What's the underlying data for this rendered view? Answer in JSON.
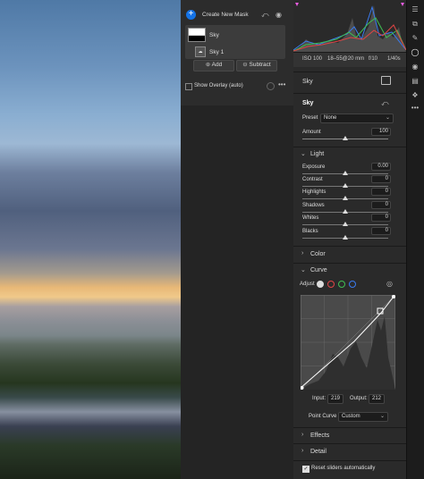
{
  "mask_panel": {
    "create_label": "Create New Mask",
    "mask_name": "Sky",
    "sub_mask_name": "Sky 1",
    "add_label": "Add",
    "subtract_label": "Subtract",
    "show_overlay_label": "Show Overlay (auto)"
  },
  "camera_info": [
    "ISO 100",
    "18–55@20 mm",
    "f/10",
    "1/40s"
  ],
  "section_title": "Sky",
  "preset": {
    "label": "Preset",
    "value": "None"
  },
  "amount": {
    "label": "Amount",
    "value": "100"
  },
  "light": {
    "title": "Light",
    "sliders": [
      {
        "label": "Exposure",
        "value": "0.00"
      },
      {
        "label": "Contrast",
        "value": "0"
      },
      {
        "label": "Highlights",
        "value": "0"
      },
      {
        "label": "Shadows",
        "value": "0"
      },
      {
        "label": "Whites",
        "value": "0"
      },
      {
        "label": "Blacks",
        "value": "0"
      }
    ]
  },
  "color_title": "Color",
  "curve": {
    "title": "Curve",
    "adjust_label": "Adjust",
    "input_label": "Input:",
    "input_value": "219",
    "output_label": "Output:",
    "output_value": "212",
    "point_curve_label": "Point Curve",
    "point_curve_value": "Custom"
  },
  "effects_title": "Effects",
  "detail_title": "Detail",
  "reset_label": "Reset sliders automatically",
  "colors": {
    "accent": "#1473e6",
    "red": "#e04545",
    "green": "#3fbf52",
    "blue": "#3a7bf0"
  },
  "icons": [
    "sliders-icon",
    "crop-icon",
    "brush-icon",
    "mask-icon",
    "redeye-icon",
    "layers-icon",
    "presets-icon",
    "more-icon"
  ]
}
